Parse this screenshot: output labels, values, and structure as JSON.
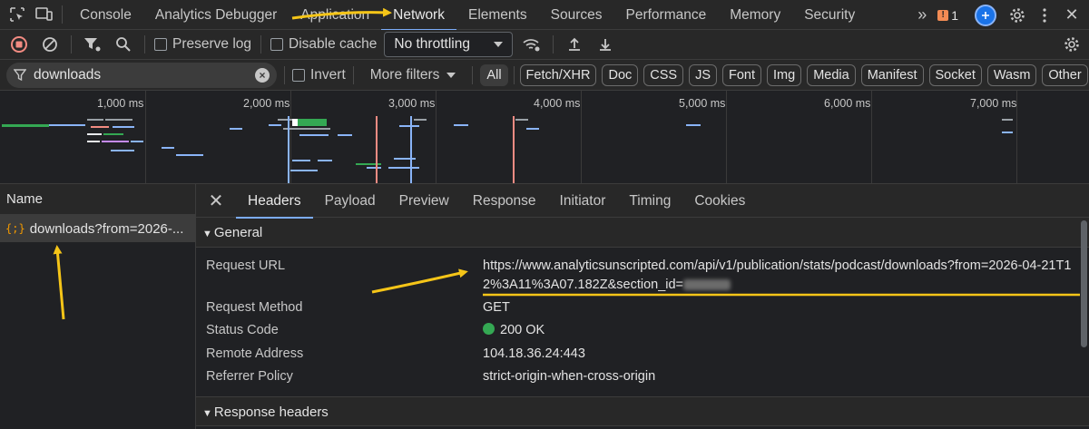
{
  "tabbar": {
    "tabs": [
      "Console",
      "Analytics Debugger",
      "Application",
      "Network",
      "Elements",
      "Sources",
      "Performance",
      "Memory",
      "Security"
    ],
    "active_tab": "Network",
    "overflow": "»",
    "issues_count": "1"
  },
  "toolbar": {
    "preserve_log": "Preserve log",
    "disable_cache": "Disable cache",
    "throttling": "No throttling"
  },
  "filter": {
    "query": "downloads",
    "invert": "Invert",
    "more_filters": "More filters",
    "chips": [
      "All",
      "Fetch/XHR",
      "Doc",
      "CSS",
      "JS",
      "Font",
      "Img",
      "Media",
      "Manifest",
      "Socket",
      "Wasm",
      "Other"
    ],
    "selected_chip": "All"
  },
  "overview": {
    "ticks": [
      "1,000 ms",
      "2,000 ms",
      "3,000 ms",
      "4,000 ms",
      "5,000 ms",
      "6,000 ms",
      "7,000 ms"
    ]
  },
  "requests": {
    "header": "Name",
    "items": [
      {
        "icon": "{;}",
        "name": "downloads?from=2026-..."
      }
    ]
  },
  "details": {
    "close": "✕",
    "tabs": [
      "Headers",
      "Payload",
      "Preview",
      "Response",
      "Initiator",
      "Timing",
      "Cookies"
    ],
    "active_tab": "Headers",
    "general": {
      "title": "General",
      "request_url_label": "Request URL",
      "request_url": "https://www.analyticsunscripted.com/api/v1/publication/stats/podcast/downloads?from=2026-04-21T12%3A11%3A07.182Z&section_id=",
      "request_method_label": "Request Method",
      "request_method": "GET",
      "status_code_label": "Status Code",
      "status_code": "200 OK",
      "remote_address_label": "Remote Address",
      "remote_address": "104.18.36.24:443",
      "referrer_policy_label": "Referrer Policy",
      "referrer_policy": "strict-origin-when-cross-origin"
    },
    "response_headers_title": "Response headers"
  },
  "colors": {
    "accent": "#7cacf8",
    "annotation": "#f5c518",
    "status_ok": "#34a853",
    "xhr_icon": "#f29900"
  }
}
